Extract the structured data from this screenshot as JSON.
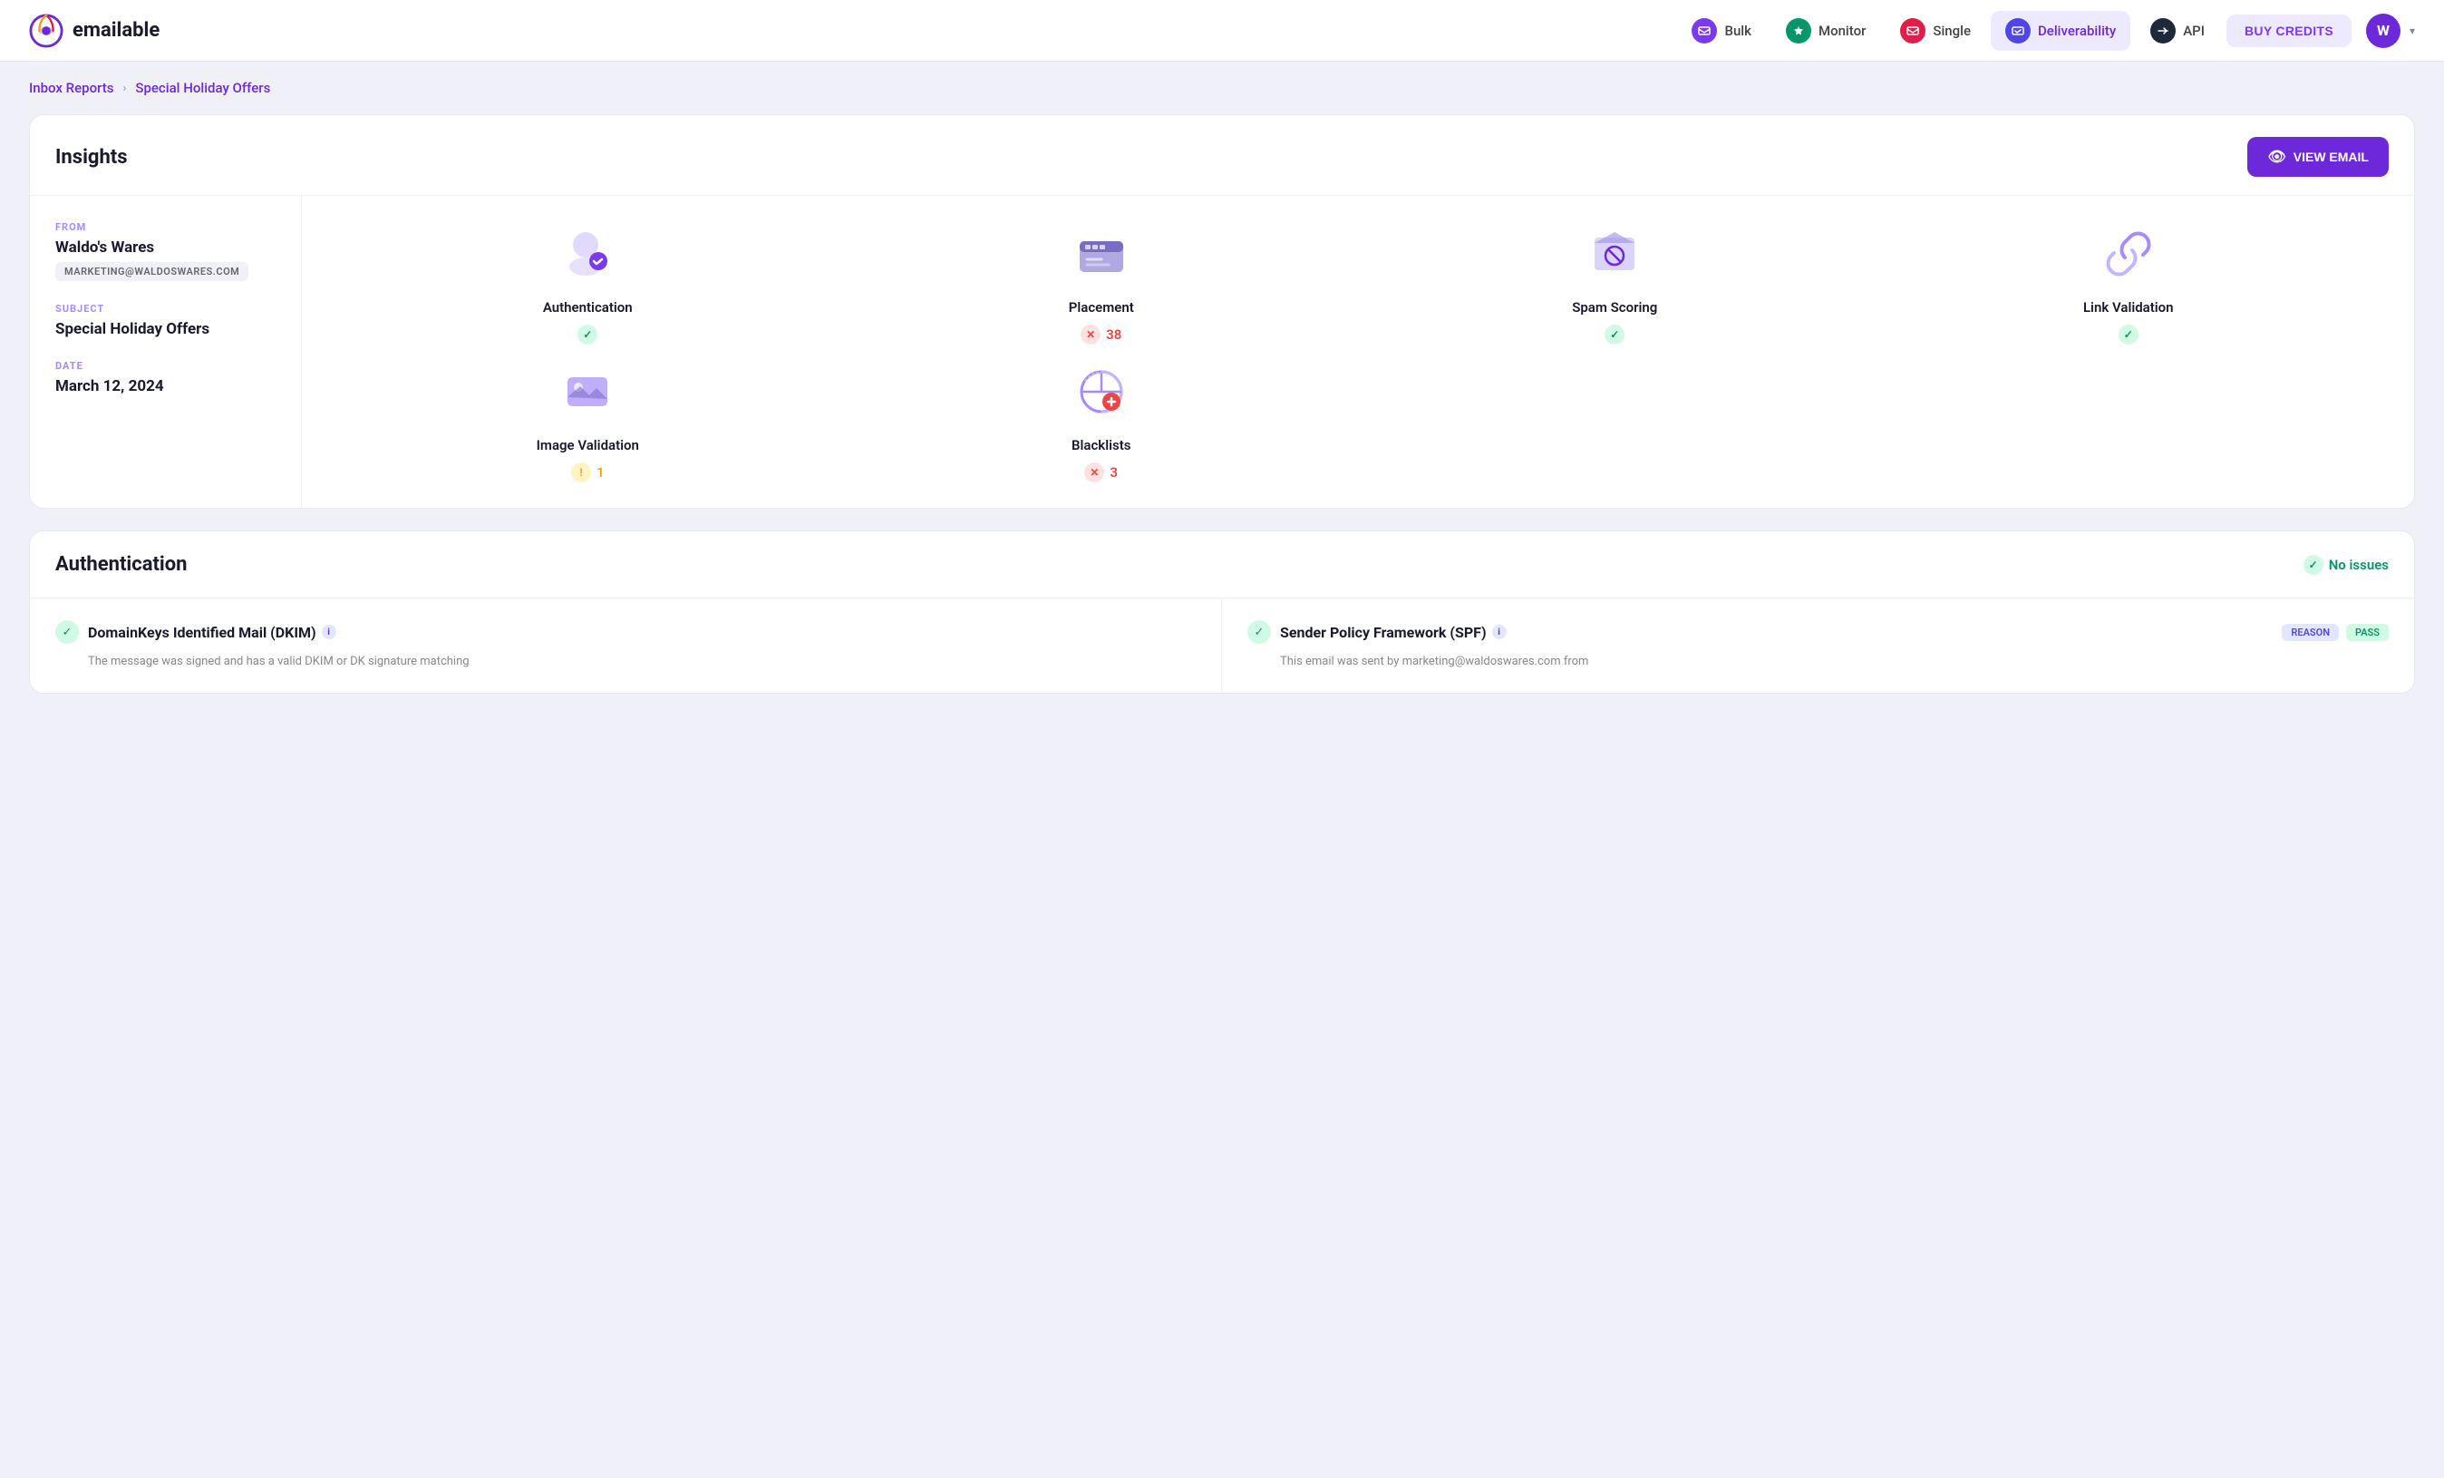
{
  "app": {
    "name": "emailable"
  },
  "nav": {
    "items": [
      {
        "id": "bulk",
        "label": "Bulk",
        "icon": "bulk",
        "active": false
      },
      {
        "id": "monitor",
        "label": "Monitor",
        "icon": "monitor",
        "active": false
      },
      {
        "id": "single",
        "label": "Single",
        "icon": "single",
        "active": false
      },
      {
        "id": "deliverability",
        "label": "Deliverability",
        "icon": "deliverability",
        "active": true
      },
      {
        "id": "api",
        "label": "API",
        "icon": "api",
        "active": false
      }
    ],
    "buy_credits": "BUY CREDITS",
    "user_initial": "W"
  },
  "breadcrumb": {
    "parent": "Inbox Reports",
    "separator": "›",
    "current": "Special Holiday Offers"
  },
  "insights": {
    "title": "Insights",
    "view_email_btn": "VIEW EMAIL",
    "from_label": "FROM",
    "from_name": "Waldo's Wares",
    "from_email": "MARKETING@WALDOSWARES.COM",
    "subject_label": "SUBJECT",
    "subject_value": "Special Holiday Offers",
    "date_label": "DATE",
    "date_value": "March 12, 2024",
    "metrics": [
      {
        "id": "authentication",
        "name": "Authentication",
        "status": "pass",
        "icon": "auth"
      },
      {
        "id": "placement",
        "name": "Placement",
        "status": "error",
        "count": "38",
        "icon": "placement"
      },
      {
        "id": "spam-scoring",
        "name": "Spam Scoring",
        "status": "pass",
        "icon": "spam"
      },
      {
        "id": "link-validation",
        "name": "Link Validation",
        "status": "pass",
        "icon": "link"
      },
      {
        "id": "image-validation",
        "name": "Image Validation",
        "status": "warn",
        "count": "1",
        "icon": "image"
      },
      {
        "id": "blacklists",
        "name": "Blacklists",
        "status": "error",
        "count": "3",
        "icon": "blacklist"
      }
    ]
  },
  "authentication_section": {
    "title": "Authentication",
    "no_issues": "No issues",
    "cells": [
      {
        "id": "dkim",
        "title": "DomainKeys Identified Mail (DKIM)",
        "desc": "The message was signed and has a valid DKIM or DK signature matching",
        "status": "pass",
        "badges": []
      },
      {
        "id": "spf",
        "title": "Sender Policy Framework (SPF)",
        "desc": "This email was sent by marketing@waldoswares.com from",
        "status": "pass",
        "badges": [
          {
            "label": "REASON",
            "type": "reason"
          },
          {
            "label": "PASS",
            "type": "pass"
          }
        ]
      }
    ]
  },
  "colors": {
    "primary": "#6d28d9",
    "success": "#059669",
    "error": "#ef4444",
    "warning": "#f59e0b",
    "light_purple": "#ede9fe",
    "icon_purple": "#8b5cf6"
  }
}
